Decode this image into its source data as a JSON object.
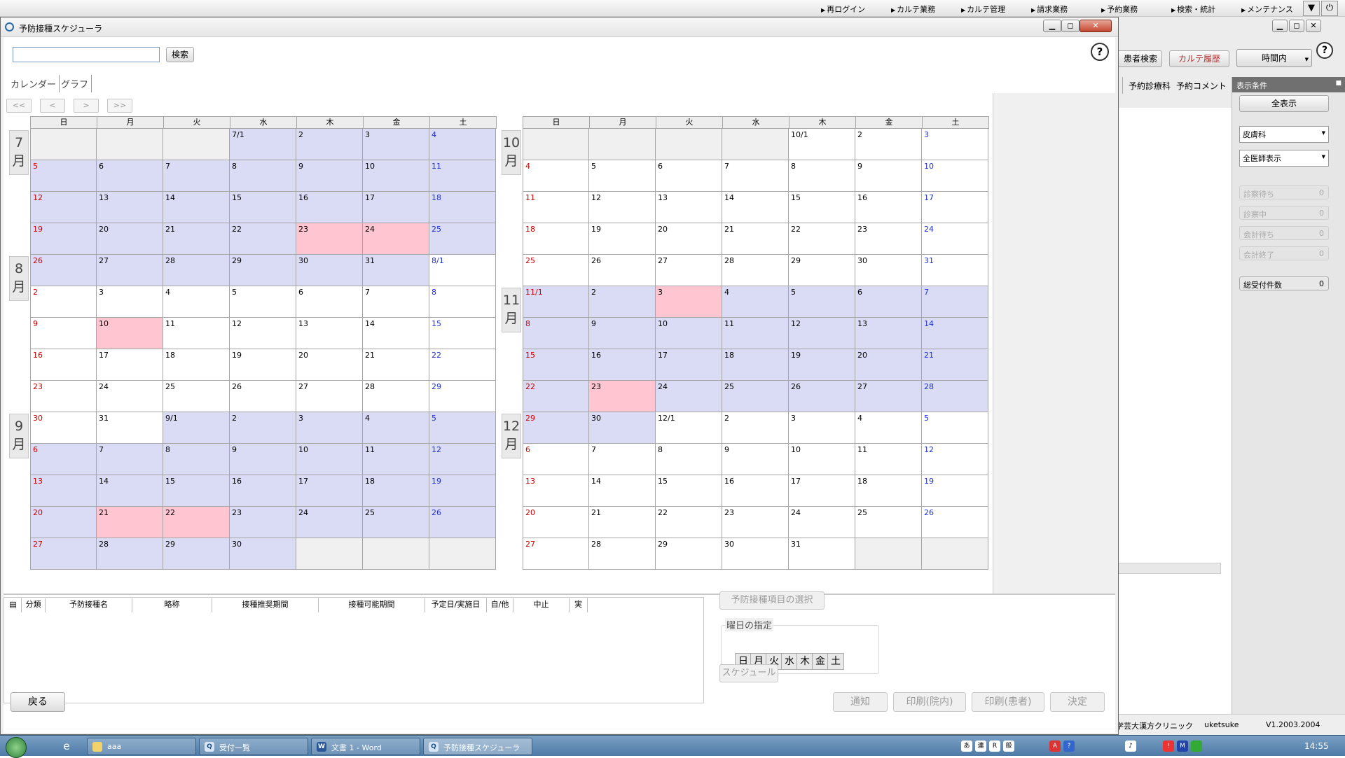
{
  "topmenu": {
    "items": [
      "再ログイン",
      "カルテ業務",
      "カルテ管理",
      "請求業務",
      "予約業務",
      "検索・統計",
      "メンテナンス"
    ]
  },
  "background_window": {
    "buttons": {
      "patient_search": "患者検索",
      "karte_history": "カルテ履歴",
      "time_select": "時間内"
    },
    "columns": [
      "予約診療科",
      "予約コメント"
    ],
    "panel": {
      "title": "表示条件",
      "show_all": "全表示",
      "department": "皮膚科",
      "doctor": "全医師表示",
      "stats": [
        {
          "label": "診察待ち",
          "count": "0"
        },
        {
          "label": "診察中",
          "count": "0"
        },
        {
          "label": "会計待ち",
          "count": "0"
        },
        {
          "label": "会計終了",
          "count": "0"
        }
      ],
      "total": {
        "label": "総受付件数",
        "count": "0"
      }
    },
    "status": {
      "clinic": "学芸大漢方クリニック",
      "user": "uketsuke",
      "version": "V1.2003.2004"
    }
  },
  "window": {
    "title": "予防接種スケジューラ",
    "search_button": "検索",
    "search_value": "",
    "help": "?",
    "tabs": [
      "カレンダー",
      "グラフ"
    ],
    "nav": [
      "<<",
      "<",
      ">",
      ">>"
    ],
    "weekdays": [
      "日",
      "月",
      "火",
      "水",
      "木",
      "金",
      "土"
    ],
    "calendar_left": {
      "month_labels": [
        {
          "text": "7\n月",
          "row": 0
        },
        {
          "text": "8\n月",
          "row": 4
        },
        {
          "text": "9\n月",
          "row": 9
        }
      ],
      "rows": [
        [
          "",
          "",
          "",
          "7/1",
          "2",
          "3",
          "4"
        ],
        [
          "5",
          "6",
          "7",
          "8",
          "9",
          "10",
          "11"
        ],
        [
          "12",
          "13",
          "14",
          "15",
          "16",
          "17",
          "18"
        ],
        [
          "19",
          "20",
          "21",
          "22",
          "23",
          "24",
          "25"
        ],
        [
          "26",
          "27",
          "28",
          "29",
          "30",
          "31",
          "8/1"
        ],
        [
          "2",
          "3",
          "4",
          "5",
          "6",
          "7",
          "8"
        ],
        [
          "9",
          "10",
          "11",
          "12",
          "13",
          "14",
          "15"
        ],
        [
          "16",
          "17",
          "18",
          "19",
          "20",
          "21",
          "22"
        ],
        [
          "23",
          "24",
          "25",
          "26",
          "27",
          "28",
          "29"
        ],
        [
          "30",
          "31",
          "9/1",
          "2",
          "3",
          "4",
          "5"
        ],
        [
          "6",
          "7",
          "8",
          "9",
          "10",
          "11",
          "12"
        ],
        [
          "13",
          "14",
          "15",
          "16",
          "17",
          "18",
          "19"
        ],
        [
          "20",
          "21",
          "22",
          "23",
          "24",
          "25",
          "26"
        ],
        [
          "27",
          "28",
          "29",
          "30",
          "",
          "",
          ""
        ]
      ],
      "shading": [
        "gggbbbb",
        "bbbbbbb",
        "bbbbbbb",
        "bbbbppb",
        "bbbbbbw",
        "wwwwwww",
        "wpwwwww",
        "wwwwwww",
        "wwwwwww",
        "wwbbbbb",
        "bbbbbbb",
        "bbbbbbb",
        "bppbbbb",
        "bbbbggg"
      ]
    },
    "calendar_right": {
      "month_labels": [
        {
          "text": "10\n月",
          "row": 0
        },
        {
          "text": "11\n月",
          "row": 5
        },
        {
          "text": "12\n月",
          "row": 9
        }
      ],
      "rows": [
        [
          "",
          "",
          "",
          "",
          "10/1",
          "2",
          "3"
        ],
        [
          "4",
          "5",
          "6",
          "7",
          "8",
          "9",
          "10"
        ],
        [
          "11",
          "12",
          "13",
          "14",
          "15",
          "16",
          "17"
        ],
        [
          "18",
          "19",
          "20",
          "21",
          "22",
          "23",
          "24"
        ],
        [
          "25",
          "26",
          "27",
          "28",
          "29",
          "30",
          "31"
        ],
        [
          "11/1",
          "2",
          "3",
          "4",
          "5",
          "6",
          "7"
        ],
        [
          "8",
          "9",
          "10",
          "11",
          "12",
          "13",
          "14"
        ],
        [
          "15",
          "16",
          "17",
          "18",
          "19",
          "20",
          "21"
        ],
        [
          "22",
          "23",
          "24",
          "25",
          "26",
          "27",
          "28"
        ],
        [
          "29",
          "30",
          "12/1",
          "2",
          "3",
          "4",
          "5"
        ],
        [
          "6",
          "7",
          "8",
          "9",
          "10",
          "11",
          "12"
        ],
        [
          "13",
          "14",
          "15",
          "16",
          "17",
          "18",
          "19"
        ],
        [
          "20",
          "21",
          "22",
          "23",
          "24",
          "25",
          "26"
        ],
        [
          "27",
          "28",
          "29",
          "30",
          "31",
          "",
          ""
        ]
      ],
      "shading": [
        "ggggwww",
        "wwwwwww",
        "wwwwwww",
        "wwwwwww",
        "wwwwwww",
        "bbpbbbb",
        "bbbbbbb",
        "bbbbbbb",
        "bpbbbbb",
        "bbwwwww",
        "wwwwwww",
        "wwwwwww",
        "wwwwwww",
        "wwwwwgg"
      ]
    },
    "table_columns": [
      "分類",
      "予防接種名",
      "略称",
      "接種推奨期間",
      "接種可能期間",
      "予定日/実施日",
      "自/他",
      "中止",
      "実"
    ],
    "select_items_button": "予防接種項目の選択",
    "weekday_group_label": "曜日の指定",
    "schedule_button": "スケジュール",
    "back_button": "戻る",
    "action_buttons": [
      "通知",
      "印刷(院内)",
      "印刷(患者)",
      "決定"
    ]
  },
  "taskbar": {
    "tasks": [
      "aaa",
      "受付一覧",
      "文書 1 - Word",
      "予防接種スケジューラ"
    ],
    "clock": "14:55",
    "ime": [
      "あ",
      "連",
      "R",
      "般"
    ]
  }
}
